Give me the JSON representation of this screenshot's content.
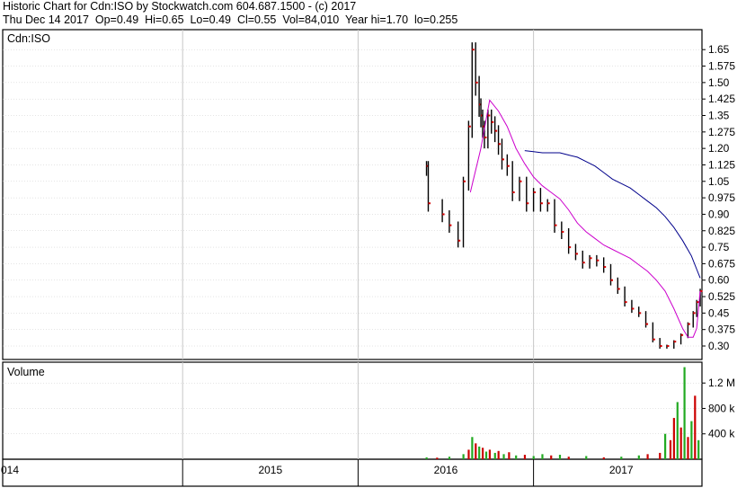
{
  "header": {
    "line1": "Historic Chart for Cdn:ISO by Stockwatch.com 604.687.1500 - (c) 2017",
    "line2": "Thu Dec 14 2017  Op=0.49  Hi=0.65  Lo=0.49  Cl=0.55  Vol=84,010  Year hi=1.70  lo=0.255"
  },
  "colors": {
    "price": "#000000",
    "close_marker": "#d40000",
    "ma_short": "#cc00cc",
    "ma_long": "#00008b",
    "volume_up": "#22aa22",
    "volume_down": "#cc0000",
    "grid": "#c8c8c8",
    "frame": "#000000"
  },
  "chart_data": [
    {
      "type": "line",
      "title": "Cdn:ISO",
      "ylabel": "",
      "xlabel": "",
      "ylim": [
        0.255,
        1.7
      ],
      "y_ticks": [
        "1.65",
        "1.575",
        "1.50",
        "1.425",
        "1.35",
        "1.275",
        "1.20",
        "1.125",
        "1.05",
        "0.975",
        "0.90",
        "0.825",
        "0.75",
        "0.675",
        "0.60",
        "0.525",
        "0.45",
        "0.375",
        "0.30"
      ],
      "x_ticks": [
        "014",
        "2015",
        "2016",
        "2017"
      ],
      "grid": true,
      "series": [
        {
          "role": "price",
          "x": [
            2016.39,
            2016.4,
            2016.48,
            2016.52,
            2016.57,
            2016.6,
            2016.63,
            2016.65,
            2016.67,
            2016.69,
            2016.7,
            2016.71,
            2016.72,
            2016.74,
            2016.76,
            2016.78,
            2016.8,
            2016.82,
            2016.85,
            2016.88,
            2016.92,
            2016.96,
            2017.0,
            2017.04,
            2017.08,
            2017.12,
            2017.16,
            2017.2,
            2017.24,
            2017.28,
            2017.32,
            2017.36,
            2017.4,
            2017.44,
            2017.48,
            2017.52,
            2017.56,
            2017.6,
            2017.64,
            2017.68,
            2017.72,
            2017.76,
            2017.8,
            2017.84,
            2017.88,
            2017.91,
            2017.93,
            2017.95
          ],
          "y": [
            1.12,
            0.95,
            0.9,
            0.85,
            0.78,
            1.05,
            1.3,
            1.65,
            1.5,
            1.4,
            1.35,
            1.3,
            1.25,
            1.35,
            1.32,
            1.28,
            1.22,
            1.15,
            1.12,
            1.0,
            1.05,
            0.95,
            1.0,
            0.95,
            0.95,
            0.85,
            0.82,
            0.75,
            0.72,
            0.68,
            0.7,
            0.69,
            0.66,
            0.6,
            0.56,
            0.5,
            0.47,
            0.45,
            0.4,
            0.33,
            0.3,
            0.3,
            0.32,
            0.35,
            0.4,
            0.45,
            0.5,
            0.55
          ]
        },
        {
          "role": "ma_short",
          "x": [
            2016.64,
            2016.7,
            2016.75,
            2016.8,
            2016.85,
            2016.9,
            2016.95,
            2017.0,
            2017.05,
            2017.1,
            2017.15,
            2017.2,
            2017.25,
            2017.3,
            2017.35,
            2017.4,
            2017.45,
            2017.5,
            2017.55,
            2017.6,
            2017.65,
            2017.7,
            2017.75,
            2017.8,
            2017.85,
            2017.88,
            2017.91,
            2017.93,
            2017.95
          ],
          "y": [
            1.0,
            1.2,
            1.42,
            1.37,
            1.3,
            1.2,
            1.13,
            1.07,
            1.03,
            1.0,
            0.97,
            0.92,
            0.86,
            0.82,
            0.79,
            0.76,
            0.74,
            0.72,
            0.7,
            0.67,
            0.64,
            0.6,
            0.55,
            0.47,
            0.38,
            0.34,
            0.34,
            0.38,
            0.55
          ]
        },
        {
          "role": "ma_long",
          "x": [
            2016.95,
            2017.0,
            2017.05,
            2017.1,
            2017.15,
            2017.2,
            2017.25,
            2017.3,
            2017.35,
            2017.4,
            2017.45,
            2017.5,
            2017.55,
            2017.6,
            2017.65,
            2017.7,
            2017.75,
            2017.8,
            2017.85,
            2017.9,
            2017.93,
            2017.95
          ],
          "y": [
            1.19,
            1.185,
            1.18,
            1.18,
            1.18,
            1.17,
            1.16,
            1.14,
            1.12,
            1.09,
            1.06,
            1.04,
            1.02,
            0.99,
            0.96,
            0.93,
            0.89,
            0.84,
            0.78,
            0.71,
            0.65,
            0.61
          ]
        }
      ]
    },
    {
      "type": "bar",
      "title": "Volume",
      "ylim": [
        0,
        1500000
      ],
      "y_ticks": [
        "1.2 M",
        "800 k",
        "400 k"
      ],
      "series": [
        {
          "role": "volume",
          "x": [
            2016.39,
            2016.45,
            2016.52,
            2016.6,
            2016.63,
            2016.65,
            2016.67,
            2016.69,
            2016.71,
            2016.73,
            2016.75,
            2016.78,
            2016.8,
            2016.83,
            2016.86,
            2016.9,
            2016.95,
            2017.0,
            2017.05,
            2017.1,
            2017.15,
            2017.2,
            2017.3,
            2017.4,
            2017.5,
            2017.6,
            2017.65,
            2017.72,
            2017.75,
            2017.78,
            2017.8,
            2017.82,
            2017.84,
            2017.86,
            2017.88,
            2017.9,
            2017.92,
            2017.94
          ],
          "y": [
            30000,
            25000,
            40000,
            80000,
            150000,
            350000,
            250000,
            200000,
            180000,
            120000,
            150000,
            100000,
            130000,
            80000,
            110000,
            60000,
            70000,
            50000,
            80000,
            60000,
            70000,
            40000,
            50000,
            30000,
            40000,
            60000,
            80000,
            100000,
            400000,
            300000,
            650000,
            900000,
            500000,
            1450000,
            350000,
            600000,
            1000000,
            300000
          ],
          "direction": [
            "up",
            "down",
            "up",
            "up",
            "down",
            "up",
            "down",
            "up",
            "down",
            "up",
            "down",
            "up",
            "down",
            "up",
            "down",
            "up",
            "down",
            "up",
            "up",
            "down",
            "up",
            "down",
            "up",
            "down",
            "up",
            "up",
            "down",
            "down",
            "up",
            "down",
            "down",
            "up",
            "down",
            "up",
            "down",
            "up",
            "down",
            "up"
          ]
        }
      ]
    }
  ]
}
